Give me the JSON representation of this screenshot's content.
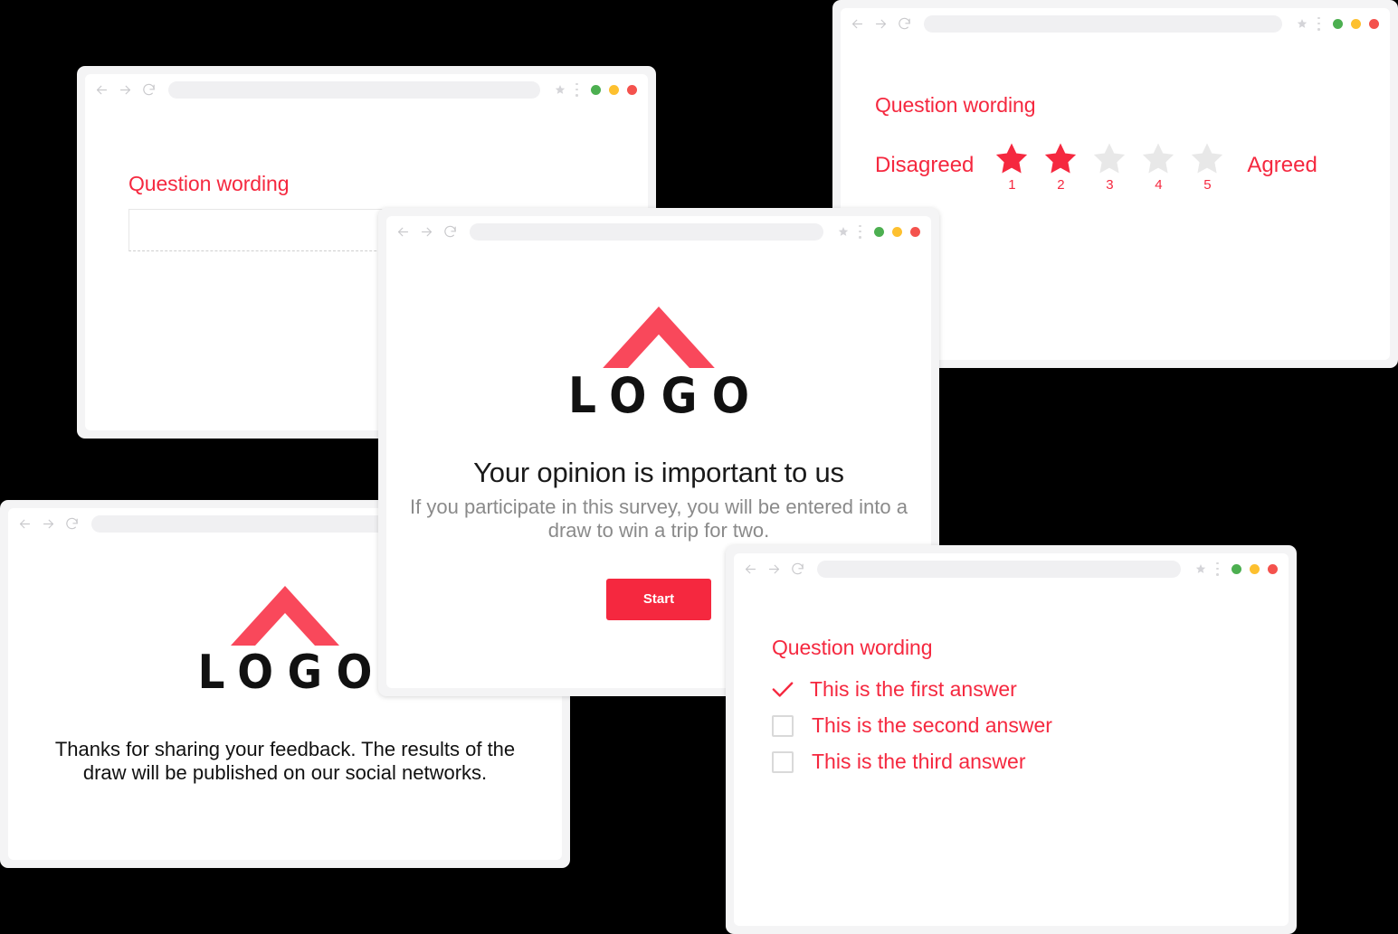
{
  "theme": {
    "accent": "#F5283F",
    "star_empty": "#E8E8E8",
    "checkbox_border": "#D9D9D9",
    "muted_text": "#8A8A8A",
    "chrome_url_bar": "#F0F0F2",
    "card_frame": "#F4F4F5",
    "background": "#000000",
    "dot_green": "#4CAF50",
    "dot_yellow": "#FDC02F",
    "dot_red": "#F4524D"
  },
  "browser_chrome": {
    "back_icon": "arrow-left-icon",
    "forward_icon": "arrow-right-icon",
    "reload_icon": "reload-icon",
    "url_value": "",
    "url_placeholder": "",
    "bookmark_icon": "star-icon",
    "menu_icon": "kebab-menu-icon",
    "window_dots": [
      "green",
      "yellow",
      "red"
    ]
  },
  "logo": {
    "mark": "chevron-roof-logo-icon",
    "wordmark": "LOGO"
  },
  "cards": {
    "open_text_question": {
      "question": "Question wording",
      "input_value": "",
      "input_placeholder": ""
    },
    "star_rating_question": {
      "question": "Question wording",
      "left_label": "Disagreed",
      "right_label": "Agreed",
      "stars": [
        {
          "number": "1",
          "filled": true
        },
        {
          "number": "2",
          "filled": true
        },
        {
          "number": "3",
          "filled": false
        },
        {
          "number": "4",
          "filled": false
        },
        {
          "number": "5",
          "filled": false
        }
      ],
      "selected_value": 2,
      "max_value": 5
    },
    "intro": {
      "headline": "Your opinion is important to us",
      "subline": "If you participate in this survey, you will be entered into a draw to win a trip for two.",
      "start_button": "Start"
    },
    "thank_you": {
      "message": "Thanks for sharing your feedback. The results of the draw will be published on our social networks."
    },
    "choice_question": {
      "question": "Question wording",
      "options": [
        {
          "label": "This is the first answer",
          "checked": true
        },
        {
          "label": "This is the second answer",
          "checked": false
        },
        {
          "label": "This is the third answer",
          "checked": false
        }
      ]
    }
  }
}
